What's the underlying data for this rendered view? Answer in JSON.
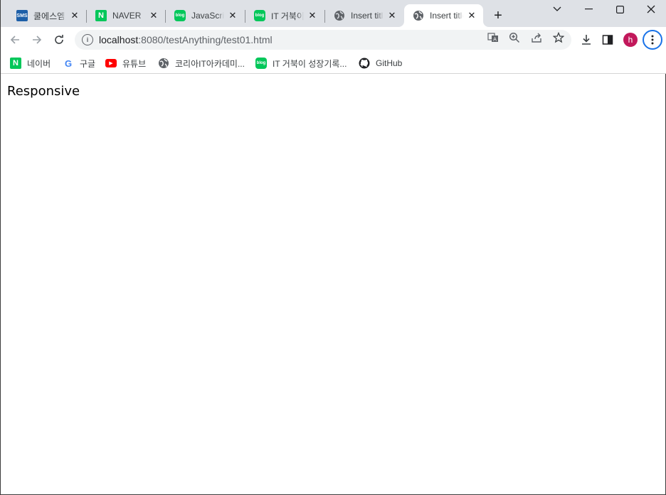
{
  "tabs": [
    {
      "title": "쿨에스엠",
      "favicon": "sms-icon",
      "favicon_text": "SMS",
      "active": false
    },
    {
      "title": "NAVER",
      "favicon": "naver-icon",
      "favicon_text": "N",
      "active": false
    },
    {
      "title": "JavaScript",
      "favicon": "blog-icon",
      "favicon_text": "blog",
      "active": false
    },
    {
      "title": "IT 거북이",
      "favicon": "blog-icon",
      "favicon_text": "blog",
      "active": false
    },
    {
      "title": "Insert title",
      "favicon": "globe-icon",
      "favicon_text": "",
      "active": false
    },
    {
      "title": "Insert title",
      "favicon": "globe-icon",
      "favicon_text": "",
      "active": true
    }
  ],
  "address_bar": {
    "host": "localhost",
    "path": ":8080/testAnything/test01.html"
  },
  "bookmarks": [
    {
      "label": "네이버",
      "icon": "naver-icon",
      "icon_text": "N"
    },
    {
      "label": "구글",
      "icon": "google-icon",
      "icon_text": "G"
    },
    {
      "label": "유튜브",
      "icon": "youtube-icon",
      "icon_text": "▶"
    },
    {
      "label": "코리아IT아카데미...",
      "icon": "globe-icon",
      "icon_text": ""
    },
    {
      "label": "IT 거북이 성장기록...",
      "icon": "blog-icon",
      "icon_text": "blog"
    },
    {
      "label": "GitHub",
      "icon": "github-icon",
      "icon_text": ""
    }
  ],
  "profile": {
    "initial": "h"
  },
  "page": {
    "heading": "Responsive"
  },
  "colors": {
    "tabstrip_bg": "#dee1e6",
    "avatar_bg": "#c2185b",
    "menu_ring": "#1a73e8",
    "naver_green": "#03c75a",
    "sms_blue": "#1d5fa8",
    "youtube_red": "#ff0000"
  }
}
